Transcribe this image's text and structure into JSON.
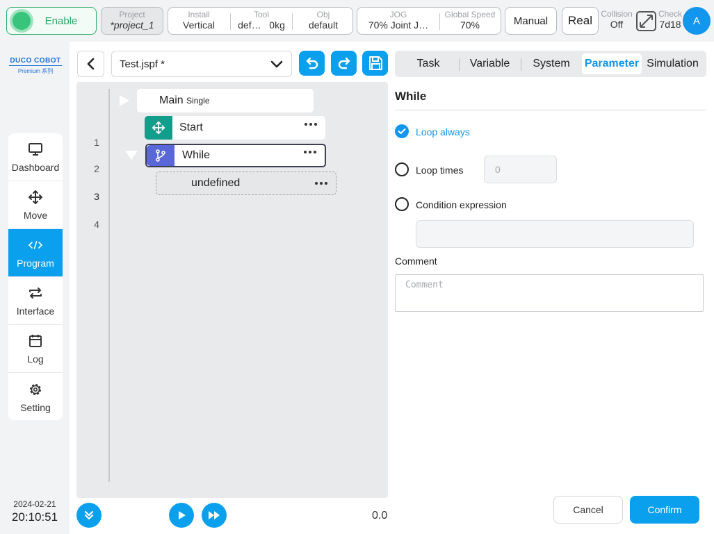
{
  "topbar": {
    "enable_label": "Enable",
    "project": {
      "label": "Project",
      "value": "*project_1"
    },
    "install": {
      "label": "Install",
      "value": "Vertical"
    },
    "tool": {
      "label": "Tool",
      "name": "def…",
      "weight": "0kg"
    },
    "obj": {
      "label": "Obj",
      "value": "default"
    },
    "jog": {
      "label": "JOG",
      "value": "70%  Joint J…"
    },
    "global_speed": {
      "label": "Global Speed",
      "value": "70%"
    },
    "mode": "Manual",
    "env": "Real",
    "collision": {
      "label": "Collision",
      "value": "Off"
    },
    "check": {
      "label": "Check",
      "value": "7d18"
    },
    "avatar_initial": "A"
  },
  "brand": {
    "name": "DUCO COBOT",
    "series": "Premium 系列"
  },
  "sidebar": {
    "items": [
      {
        "label": "Dashboard",
        "icon": "monitor-icon"
      },
      {
        "label": "Move",
        "icon": "move-arrows-icon"
      },
      {
        "label": "Program",
        "icon": "code-icon",
        "active": true
      },
      {
        "label": "Interface",
        "icon": "swap-arrows-icon"
      },
      {
        "label": "Log",
        "icon": "calendar-icon"
      },
      {
        "label": "Setting",
        "icon": "gear-icon"
      }
    ],
    "date": "2024-02-21",
    "time": "20:10:51"
  },
  "program": {
    "file_name": "Test.jspf *",
    "speed_value": "0.0",
    "lines": [
      {
        "num": "1",
        "label": "Main",
        "sub": "Single"
      },
      {
        "num": "2",
        "label": "Start",
        "icon": "move-arrows-icon"
      },
      {
        "num": "3",
        "label": "While",
        "icon": "branch-icon"
      },
      {
        "num": "4",
        "label": "undefined"
      }
    ]
  },
  "tabs": [
    "Task",
    "Variable",
    "System",
    "Parameter",
    "Simulation"
  ],
  "parameter": {
    "title": "While",
    "loop_always": "Loop always",
    "loop_times": "Loop times",
    "loop_times_placeholder": "0",
    "condition": "Condition expression",
    "comment_label": "Comment",
    "comment_placeholder": "Comment",
    "cancel": "Cancel",
    "confirm": "Confirm"
  },
  "colors": {
    "accent": "#0aa0ee",
    "enable": "#38c47b",
    "start_node": "#139e8c",
    "while_node": "#5a67d8"
  }
}
